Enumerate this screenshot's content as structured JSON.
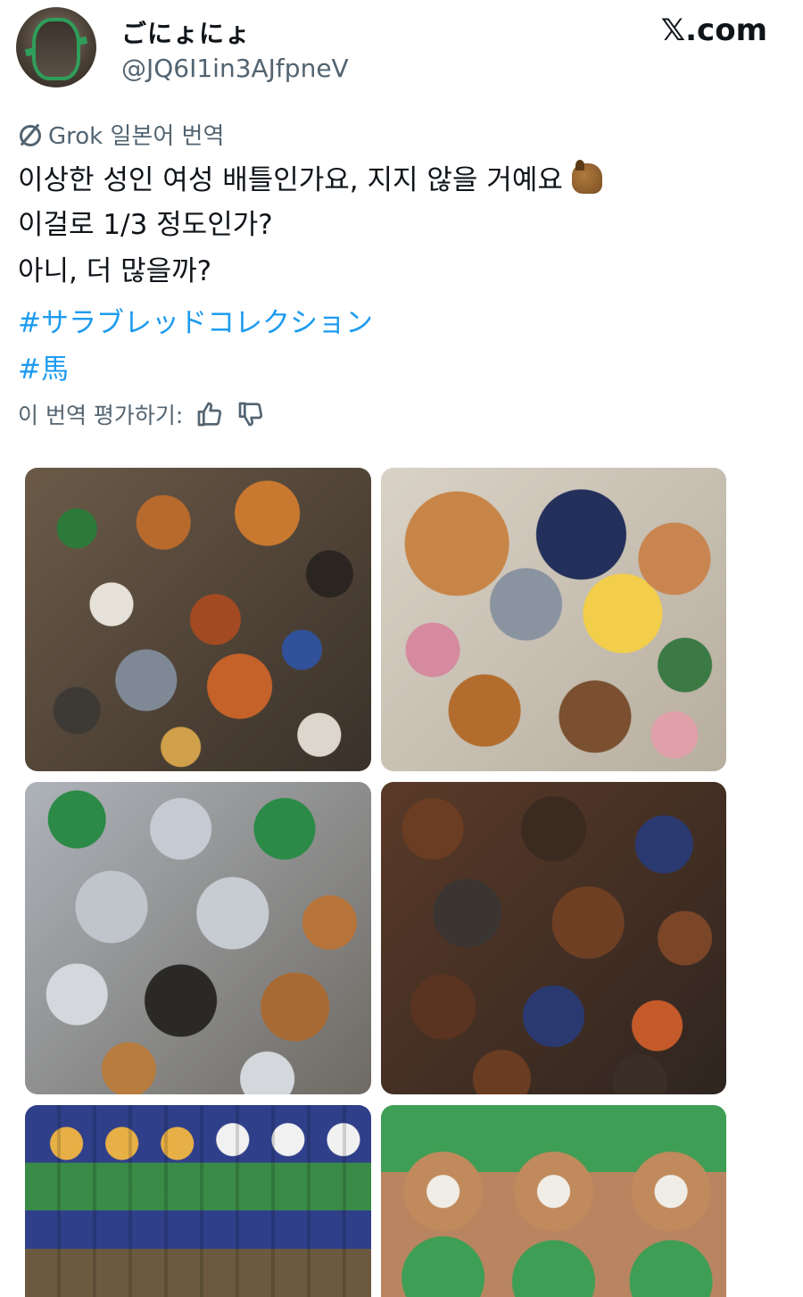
{
  "user": {
    "display_name": "ごにょにょ",
    "handle": "@JQ6I1in3AJfpneV"
  },
  "brand": {
    "label": "𝕏.com"
  },
  "translation": {
    "label": "Grok 일본어 번역"
  },
  "post": {
    "lines": [
      "이상한 성인 여성 배틀인가요, 지지 않을 거예요",
      "이걸로 1/3 정도인가?",
      "아니, 더 많을까?"
    ],
    "hashtags": [
      "#サラブレッドコレクション",
      "#馬"
    ]
  },
  "rating": {
    "label": "이 번역 평가하기:"
  },
  "media": {
    "count": 6
  },
  "colors": {
    "link": "#1d9bf0",
    "secondary_text": "#536471",
    "primary_text": "#0f1419"
  }
}
